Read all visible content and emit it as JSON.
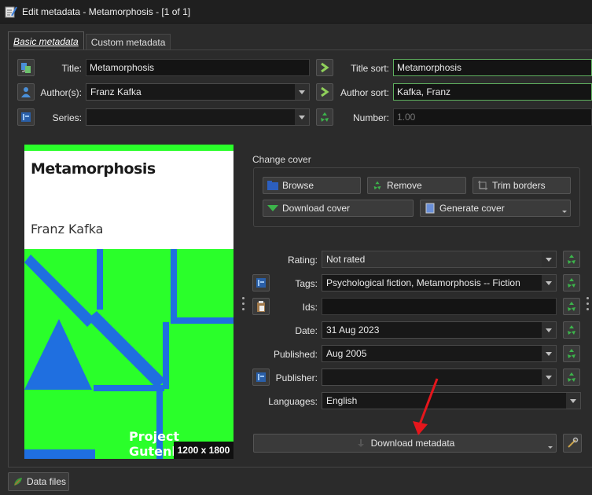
{
  "window": {
    "title": "Edit metadata - Metamorphosis -  [1 of 1]"
  },
  "tabs": [
    {
      "label": "Basic metadata",
      "active": true
    },
    {
      "label": "Custom metadata",
      "active": false
    }
  ],
  "fields": {
    "title": {
      "label": "Title:",
      "value": "Metamorphosis"
    },
    "title_sort": {
      "label": "Title sort:",
      "value": "Metamorphosis"
    },
    "authors": {
      "label": "Author(s):",
      "value": "Franz Kafka"
    },
    "author_sort": {
      "label": "Author sort:",
      "value": "Kafka, Franz"
    },
    "series": {
      "label": "Series:",
      "value": ""
    },
    "number": {
      "label": "Number:",
      "value": "1.00"
    },
    "rating": {
      "label": "Rating:",
      "value": "Not rated"
    },
    "tags": {
      "label": "Tags:",
      "value": "Psychological fiction, Metamorphosis -- Fiction"
    },
    "ids": {
      "label": "Ids:",
      "value": ""
    },
    "date": {
      "label": "Date:",
      "value": "31 Aug 2023"
    },
    "published": {
      "label": "Published:",
      "value": "Aug 2005"
    },
    "publisher": {
      "label": "Publisher:",
      "value": ""
    },
    "languages": {
      "label": "Languages:",
      "value": "English"
    }
  },
  "cover": {
    "book_title": "Metamorphosis",
    "book_author": "Franz Kafka",
    "publisher_mark": "Project Gutenberg",
    "size_badge": "1200 x 1800"
  },
  "change_cover": {
    "label": "Change cover",
    "browse": "Browse",
    "remove": "Remove",
    "trim_borders": "Trim borders",
    "download_cover": "Download cover",
    "generate_cover": "Generate cover"
  },
  "download_metadata": "Download metadata",
  "data_files": "Data files",
  "colors": {
    "cover_green": "#2aff2a",
    "cover_blue": "#1f6fe0",
    "accent_green": "#5fb05f",
    "arrow_red": "#e5161c"
  }
}
